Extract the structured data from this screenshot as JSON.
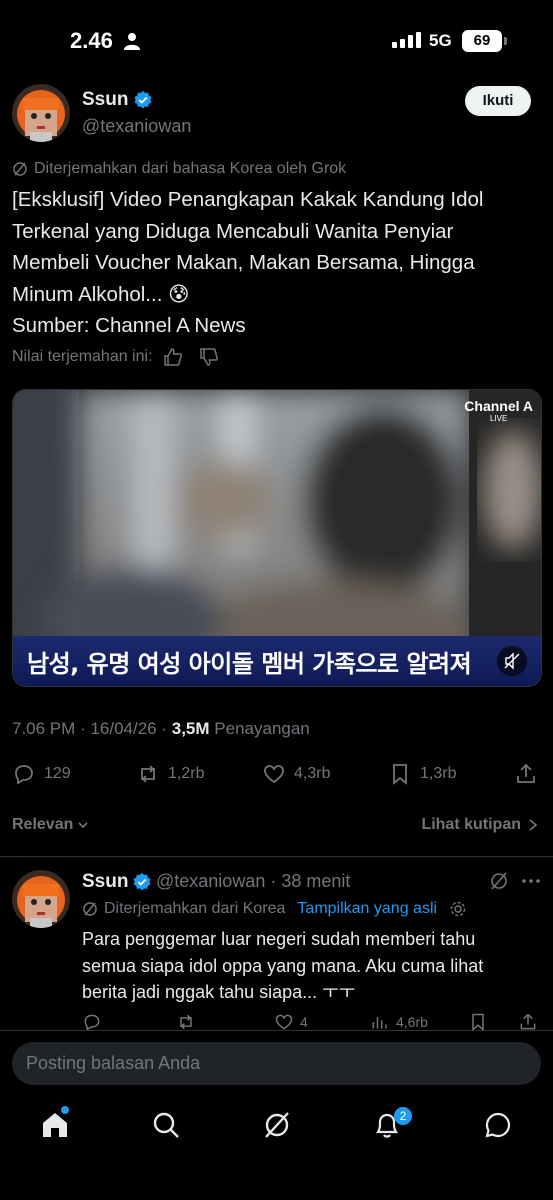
{
  "status_bar": {
    "time": "2.46",
    "network": "5G",
    "battery": "69"
  },
  "post": {
    "author_name": "Ssun",
    "author_handle": "@texaniowan",
    "follow_label": "Ikuti",
    "translated_note": "Diterjemahkan dari bahasa Korea oleh Grok",
    "text_lines": [
      "[Eksklusif] Video Penangkapan Kakak Kandung Idol",
      "Terkenal yang Diduga Mencabuli Wanita Penyiar",
      "Membeli Voucher Makan, Makan Bersama, Hingga",
      "Minum Alkohol... 😰",
      "Sumber: Channel A News"
    ],
    "rate_label": "Nilai terjemahan ini:",
    "video": {
      "channel": "Channel A",
      "channel_sub": "LIVE",
      "caption": "남성, 유명 여성 아이돌 멤버 가족으로 알려져"
    },
    "time": "7.06 PM",
    "date": "16/04/26",
    "views": "3,5M",
    "views_label": "Penayangan",
    "stats": {
      "replies": "129",
      "reposts": "1,2rb",
      "likes": "4,3rb",
      "bookmarks": "1,3rb"
    }
  },
  "sort": {
    "label": "Relevan",
    "quotes_label": "Lihat kutipan"
  },
  "reply": {
    "author_name": "Ssun",
    "meta": "@texaniowan · 38 menit",
    "translated_note": "Diterjemahkan dari Korea",
    "show_original": "Tampilkan yang asli",
    "text_lines": [
      "Para penggemar luar negeri sudah memberi tahu",
      "semua siapa idol oppa yang mana. Aku cuma lihat",
      "berita jadi nggak tahu siapa... ㅜㅜ"
    ],
    "stats": {
      "likes": "4",
      "views": "4,6rb"
    }
  },
  "reply_input": {
    "placeholder": "Posting balasan Anda"
  },
  "nav": {
    "notifications_badge": "2"
  },
  "colors": {
    "accent": "#1d9bf0",
    "muted": "#71767b",
    "text": "#e7e9ea"
  }
}
